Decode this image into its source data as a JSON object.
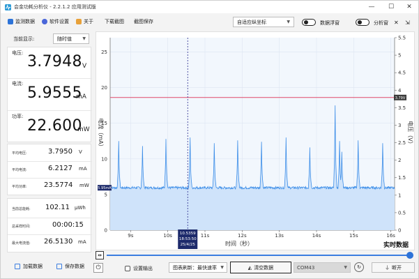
{
  "window": {
    "title": "会金功耗分析仪 - 2.2.1.2 应用测试版",
    "controls": {
      "minimize": "—",
      "maximize": "☐",
      "close": "✕"
    }
  },
  "toolbar": {
    "items": [
      {
        "label": "监测数据",
        "icon": "monitor-icon",
        "color": "#2d73d8"
      },
      {
        "label": "软件设置",
        "icon": "gear-icon",
        "color": "#4a66d9"
      },
      {
        "label": "关于",
        "icon": "info-icon",
        "color": "#e8a13a"
      },
      {
        "label": "下载截图",
        "icon": "",
        "color": ""
      },
      {
        "label": "截图保存",
        "icon": "",
        "color": ""
      }
    ],
    "coord_select": "自适应纵坐标",
    "toggle1_label": "数据浮窗",
    "toggle2_label": "分析窗",
    "icon_x": "✕",
    "icon_pin": "⇲"
  },
  "left": {
    "display_label": "当前显示:",
    "display_select": "随时值",
    "voltage": {
      "label": "电压:",
      "value": "3.7948",
      "unit": "V"
    },
    "current": {
      "label": "电流:",
      "value": "5.9555",
      "unit": "mA"
    },
    "power": {
      "label": "功率:",
      "value": "22.600",
      "unit": "mW"
    },
    "avg_voltage": {
      "label": "平均电压:",
      "value": "3.7950",
      "unit": "V"
    },
    "avg_current": {
      "label": "平均电流:",
      "value": "6.2127",
      "unit": "mA"
    },
    "avg_power": {
      "label": "平均功率:",
      "value": "23.5774",
      "unit": "mW"
    },
    "total_energy": {
      "label": "当前总能耗:",
      "value": "102.11",
      "unit": "μWh"
    },
    "total_time": {
      "label": "总采样时间:",
      "value": "00:00:15"
    },
    "max_current": {
      "label": "最大电流值:",
      "value": "26.5130",
      "unit": "mA"
    },
    "load_btn": "加载数据",
    "save_btn": "保存数据"
  },
  "chart_labels": {
    "xlabel": "时间（秒）",
    "ylabel_left": "电流（mA）",
    "ylabel_right": "电压（V）",
    "realtime": "实时数据",
    "cursor_value": "10.5359",
    "cursor_time": "18:53:50",
    "cursor_date": "25/4/25",
    "voltage_marker": "3.79V",
    "current_marker": "5.95mA"
  },
  "chart_data": {
    "type": "line",
    "xlabel": "时间（秒）",
    "ylabel": "电流（mA）",
    "y2label": "电压（V）",
    "xlim": [
      8.45,
      16.1
    ],
    "ylim": [
      0,
      27
    ],
    "y2lim": [
      0,
      5.5
    ],
    "x_ticks": [
      "9s",
      "10s",
      "11s",
      "12s",
      "13s",
      "14s",
      "15s",
      "16s"
    ],
    "y_ticks": [
      0,
      5,
      10,
      15,
      20,
      25
    ],
    "y2_ticks": [
      0,
      0.5,
      1,
      1.5,
      2,
      2.5,
      3,
      3.5,
      4,
      4.5,
      5,
      5.5
    ],
    "series": [
      {
        "name": "电流（mA）",
        "color": "#3d8ee8",
        "baseline": 5.95,
        "spike_x": [
          8.68,
          9.32,
          9.95,
          10.6,
          11.25,
          11.88,
          12.52,
          13.18,
          13.82,
          14.5,
          14.62,
          14.68,
          15.12,
          15.78
        ],
        "spike_y": [
          12.5,
          11.8,
          12.8,
          13.0,
          12.2,
          12.6,
          12.4,
          13.0,
          11.6,
          17.5,
          12.5,
          11.0,
          12.6,
          12.2
        ]
      },
      {
        "name": "电压（V）",
        "color": "#e0486a",
        "values": [
          3.79
        ]
      }
    ],
    "cursor_x": 10.5359
  },
  "bottom": {
    "settings_btn": "设置输出",
    "rate_select": "图表刷新：最快速率",
    "clear_btn": "清空数据",
    "com_select": "COM43",
    "disconnect_btn": "断开"
  }
}
